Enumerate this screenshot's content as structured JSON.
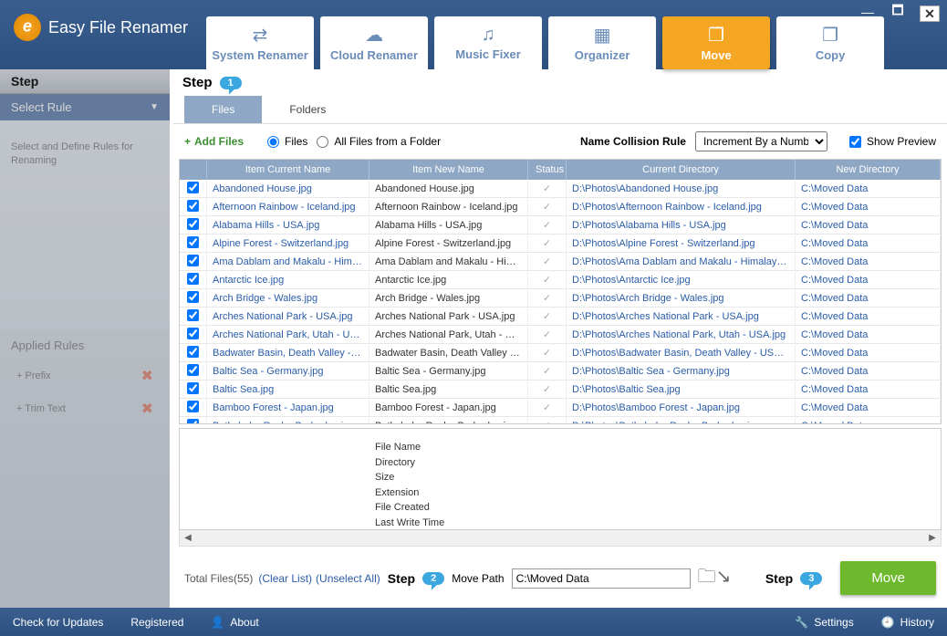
{
  "app_title": "Easy File Renamer",
  "window_controls": {
    "min": "—",
    "max": "🗖",
    "close": "✕"
  },
  "main_tabs": [
    {
      "label": "System Renamer",
      "icon": "⇄"
    },
    {
      "label": "Cloud Renamer",
      "icon": "☁"
    },
    {
      "label": "Music Fixer",
      "icon": "♫"
    },
    {
      "label": "Organizer",
      "icon": "▦"
    },
    {
      "label": "Move",
      "icon": "❐",
      "active": true
    },
    {
      "label": "Copy",
      "icon": "❐"
    }
  ],
  "sidebar": {
    "step_label": "Step",
    "select_rule": "Select Rule",
    "hint": "Select and Define Rules for Renaming",
    "applied_rules_label": "Applied Rules",
    "rules": [
      {
        "label": "+ Prefix"
      },
      {
        "label": "+ Trim Text"
      }
    ]
  },
  "main_area": {
    "step_label": "Step",
    "step_num": "1",
    "sub_tabs": [
      "Files",
      "Folders"
    ],
    "add_files": "Add Files",
    "radio_files": "Files",
    "radio_folder": "All Files from a Folder",
    "collision_label": "Name Collision Rule",
    "collision_value": "Increment By a Number",
    "show_preview": "Show Preview",
    "columns": {
      "name": "Item Current Name",
      "new_name": "Item New Name",
      "status": "Status",
      "dir": "Current Directory",
      "new_dir": "New Directory"
    },
    "rows": [
      {
        "name": "Abandoned House.jpg",
        "new_name": "Abandoned House.jpg",
        "dir": "D:\\Photos\\Abandoned House.jpg",
        "new_dir": "C:\\Moved Data"
      },
      {
        "name": "Afternoon Rainbow - Iceland.jpg",
        "new_name": "Afternoon Rainbow - Iceland.jpg",
        "dir": "D:\\Photos\\Afternoon Rainbow - Iceland.jpg",
        "new_dir": "C:\\Moved Data"
      },
      {
        "name": "Alabama Hills - USA.jpg",
        "new_name": "Alabama Hills - USA.jpg",
        "dir": "D:\\Photos\\Alabama Hills - USA.jpg",
        "new_dir": "C:\\Moved Data"
      },
      {
        "name": "Alpine Forest - Switzerland.jpg",
        "new_name": "Alpine Forest - Switzerland.jpg",
        "dir": "D:\\Photos\\Alpine Forest - Switzerland.jpg",
        "new_dir": "C:\\Moved Data"
      },
      {
        "name": "Ama Dablam and Makalu - Himal...",
        "new_name": "Ama Dablam and Makalu - Himalay",
        "dir": "D:\\Photos\\Ama Dablam and Makalu - Himalayas.jpg",
        "new_dir": "C:\\Moved Data"
      },
      {
        "name": "Antarctic Ice.jpg",
        "new_name": "Antarctic Ice.jpg",
        "dir": "D:\\Photos\\Antarctic Ice.jpg",
        "new_dir": "C:\\Moved Data"
      },
      {
        "name": "Arch Bridge - Wales.jpg",
        "new_name": "Arch Bridge - Wales.jpg",
        "dir": "D:\\Photos\\Arch Bridge - Wales.jpg",
        "new_dir": "C:\\Moved Data"
      },
      {
        "name": "Arches National Park - USA.jpg",
        "new_name": "Arches National Park - USA.jpg",
        "dir": "D:\\Photos\\Arches National Park - USA.jpg",
        "new_dir": "C:\\Moved Data"
      },
      {
        "name": "Arches National Park, Utah - USA.jpg",
        "new_name": "Arches National Park, Utah - USA.j",
        "dir": "D:\\Photos\\Arches National Park, Utah - USA.jpg",
        "new_dir": "C:\\Moved Data"
      },
      {
        "name": "Badwater Basin, Death Valley - US...",
        "new_name": "Badwater Basin, Death Valley - USA",
        "dir": "D:\\Photos\\Badwater Basin, Death Valley - USA.jpg",
        "new_dir": "C:\\Moved Data"
      },
      {
        "name": "Baltic Sea - Germany.jpg",
        "new_name": "Baltic Sea - Germany.jpg",
        "dir": "D:\\Photos\\Baltic Sea - Germany.jpg",
        "new_dir": "C:\\Moved Data"
      },
      {
        "name": "Baltic Sea.jpg",
        "new_name": "Baltic Sea.jpg",
        "dir": "D:\\Photos\\Baltic Sea.jpg",
        "new_dir": "C:\\Moved Data"
      },
      {
        "name": "Bamboo Forest - Japan.jpg",
        "new_name": "Bamboo Forest - Japan.jpg",
        "dir": "D:\\Photos\\Bamboo Forest - Japan.jpg",
        "new_dir": "C:\\Moved Data"
      },
      {
        "name": "Bathsheba Rock - Barbados.jpg",
        "new_name": "Bathsheba Rock - Barbados.jpg",
        "dir": "D:\\Photos\\Bathsheba Rock - Barbados.jpg",
        "new_dir": "C:\\Moved Data"
      }
    ],
    "detail_fields": [
      "File Name",
      "Directory",
      "Size",
      "Extension",
      "File Created",
      "Last Write Time"
    ]
  },
  "bottom": {
    "total_label": "Total Files(55)",
    "clear_list": "(Clear List)",
    "unselect_all": "(Unselect All)",
    "step2_label": "Step",
    "step2_num": "2",
    "move_path_label": "Move Path",
    "move_path_value": "C:\\Moved Data",
    "step3_label": "Step",
    "step3_num": "3",
    "move_btn": "Move"
  },
  "footer": {
    "check_updates": "Check for Updates",
    "registered": "Registered",
    "about": "About",
    "settings": "Settings",
    "history": "History"
  }
}
